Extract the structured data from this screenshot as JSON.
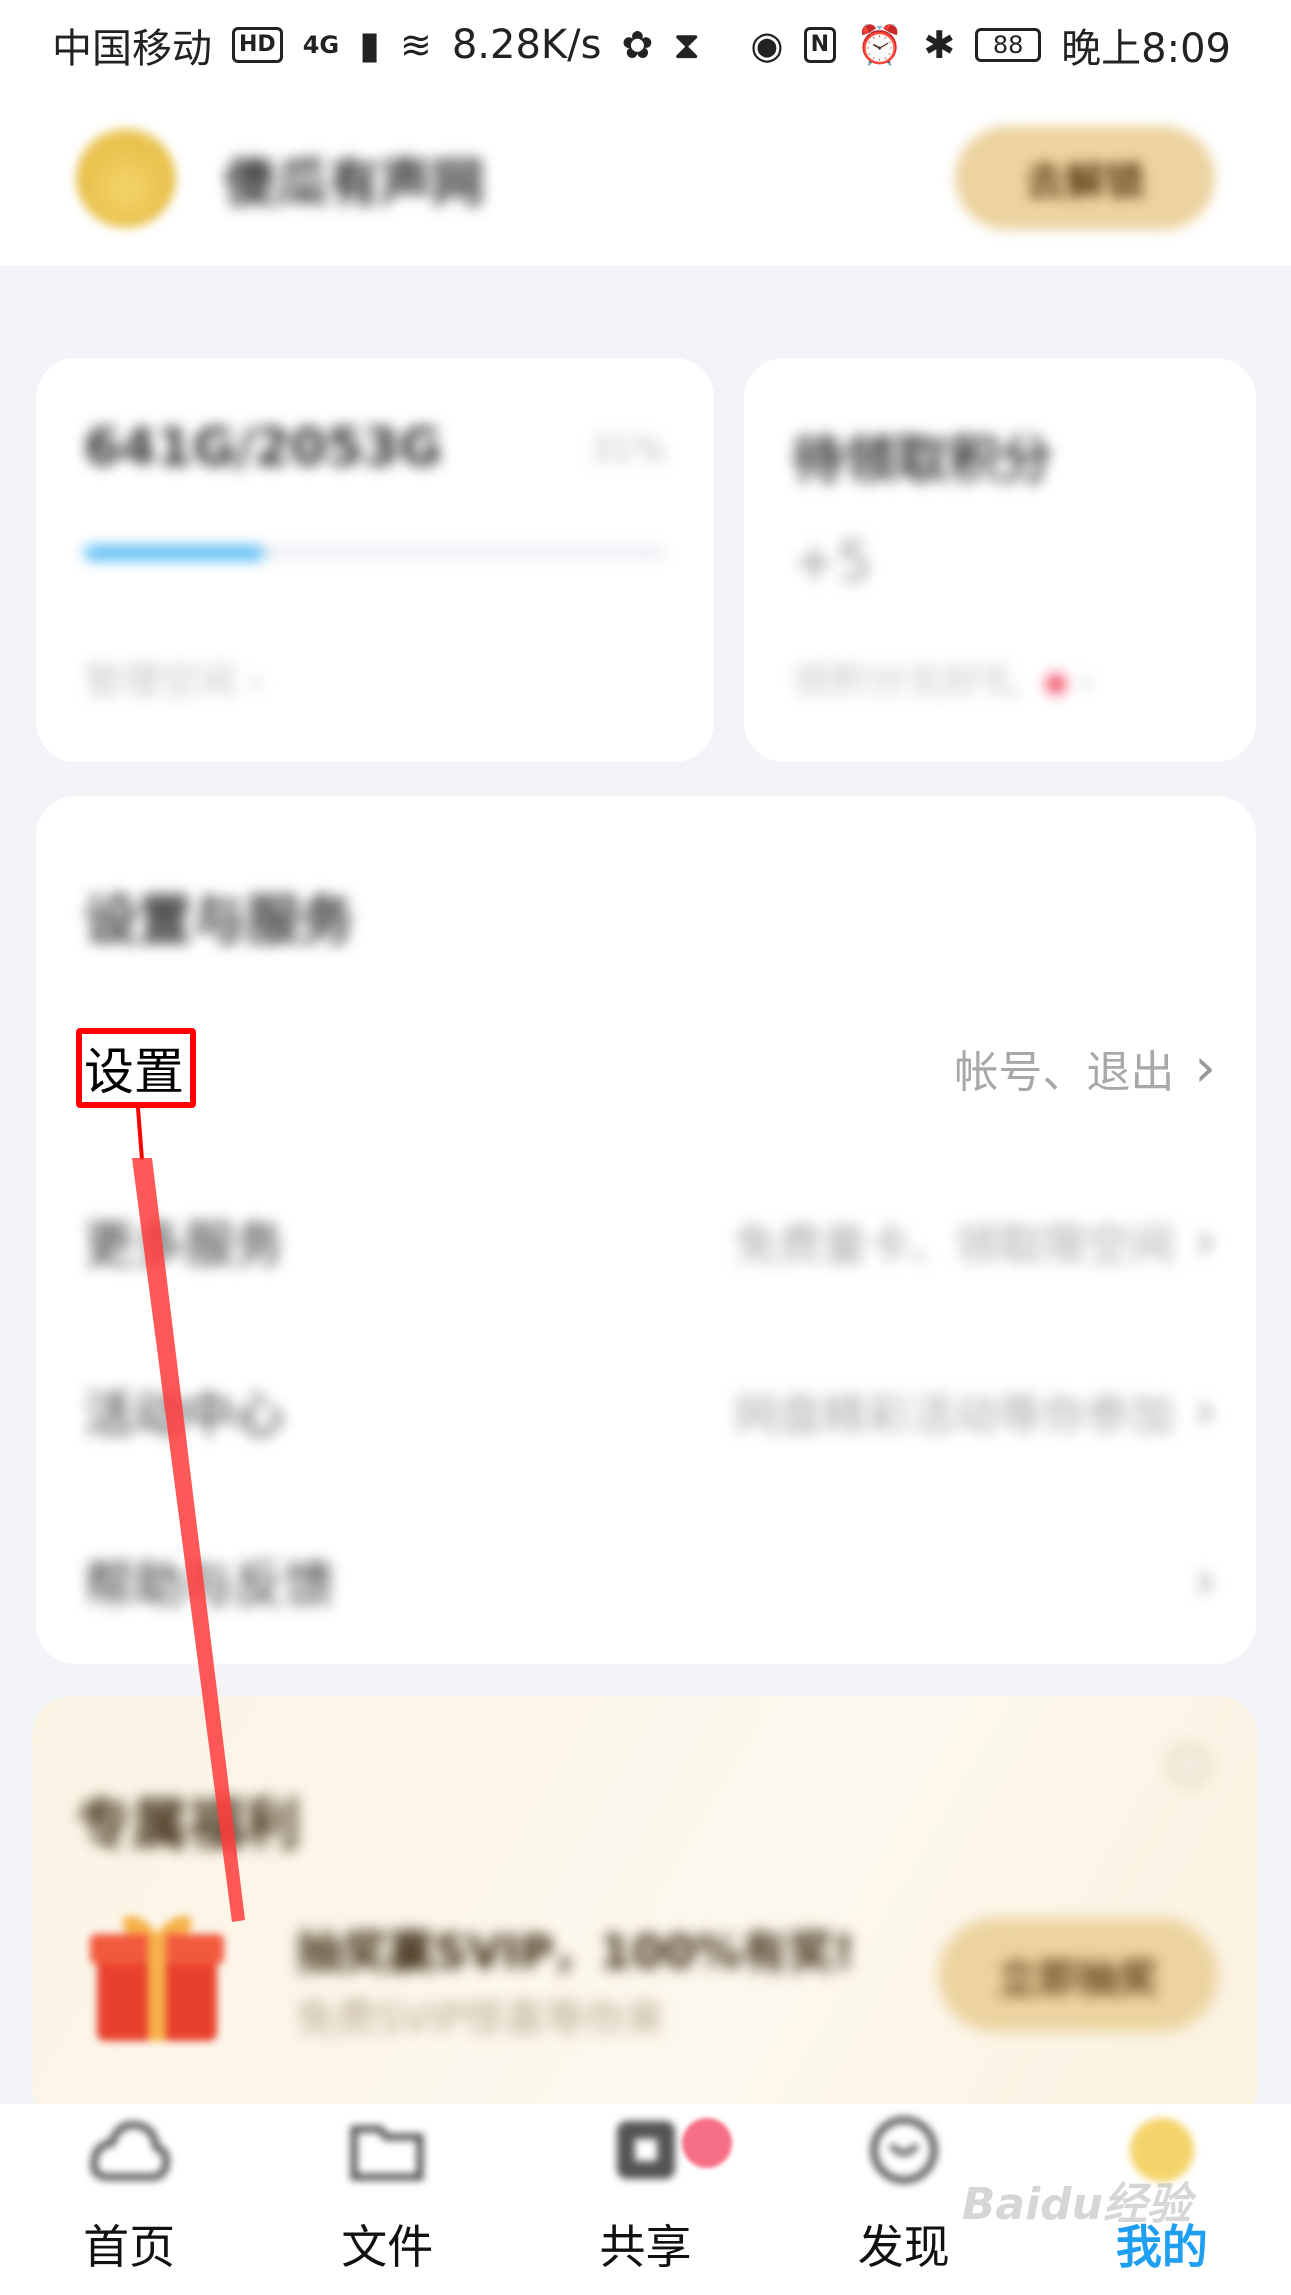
{
  "status_bar": {
    "carrier": "中国移动",
    "hd": "HD",
    "network": "4G",
    "speed": "8.28K/s",
    "battery": "88",
    "time": "晚上8:09"
  },
  "header": {
    "username": "傻瓜有声网",
    "unlock_label": "去解锁"
  },
  "storage": {
    "value": "641G/2053G",
    "percent": "31%",
    "progress": 0.31,
    "manage_label": "管理空间"
  },
  "points": {
    "title": "待领取积分",
    "value": "+5",
    "link_label": "领积分兑好礼"
  },
  "settings_section": {
    "title": "设置与服务",
    "items": [
      {
        "label": "设置",
        "desc": "帐号、退出"
      },
      {
        "label": "更多服务",
        "desc": "免费量卡、领取限空间"
      },
      {
        "label": "活动中心",
        "desc": "网盘精彩活动等你参加"
      },
      {
        "label": "帮助与反馈",
        "desc": ""
      }
    ]
  },
  "promo": {
    "title": "专属福利",
    "headline": "抽奖赢SVIP，100%有奖!",
    "subtitle": "免费SVIP惊喜等你来",
    "button_label": "立即抽奖"
  },
  "bottom_nav": [
    {
      "label": "首页",
      "icon": "home-icon"
    },
    {
      "label": "文件",
      "icon": "folder-icon"
    },
    {
      "label": "共享",
      "icon": "share-icon"
    },
    {
      "label": "发现",
      "icon": "discover-icon"
    },
    {
      "label": "我的",
      "icon": "profile-icon"
    }
  ],
  "watermark": "Baidu经验",
  "colors": {
    "accent": "#1e9ff2",
    "progress": "#4cb6f4",
    "gold_button": "#ecd3a0",
    "annotation": "#ff0000"
  }
}
